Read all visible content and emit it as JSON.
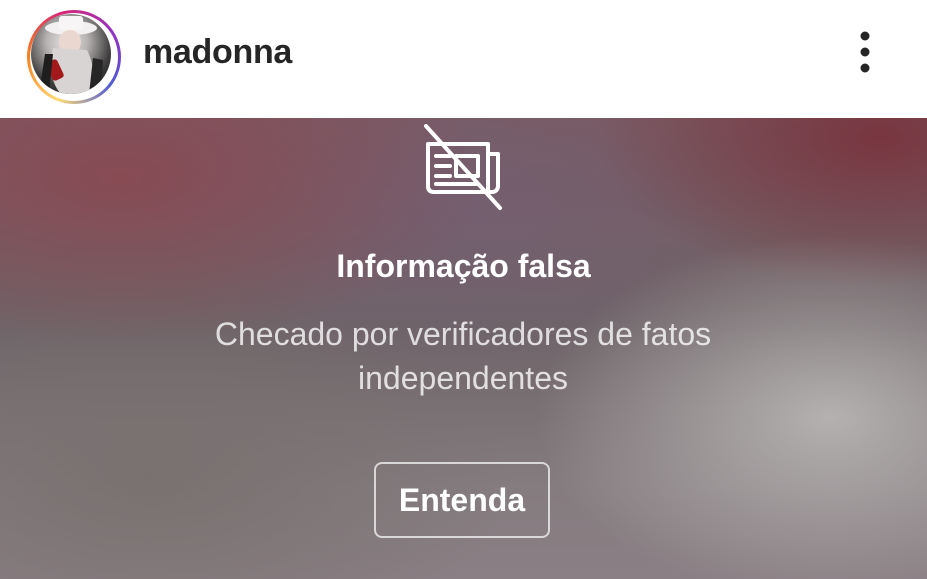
{
  "header": {
    "username": "madonna",
    "avatar_icon": "profile-photo",
    "menu_icon": "more-vertical-icon",
    "story_ring_colors": [
      "#feda75",
      "#fa7e1e",
      "#d62976",
      "#962fbf",
      "#4f5bd5"
    ]
  },
  "warning": {
    "icon": "news-off-icon",
    "title": "Informação falsa",
    "subtitle": "Checado por verificadores de fatos independentes",
    "button_label": "Entenda"
  },
  "colors": {
    "text_primary": "#262626",
    "overlay_text": "#ffffff"
  }
}
